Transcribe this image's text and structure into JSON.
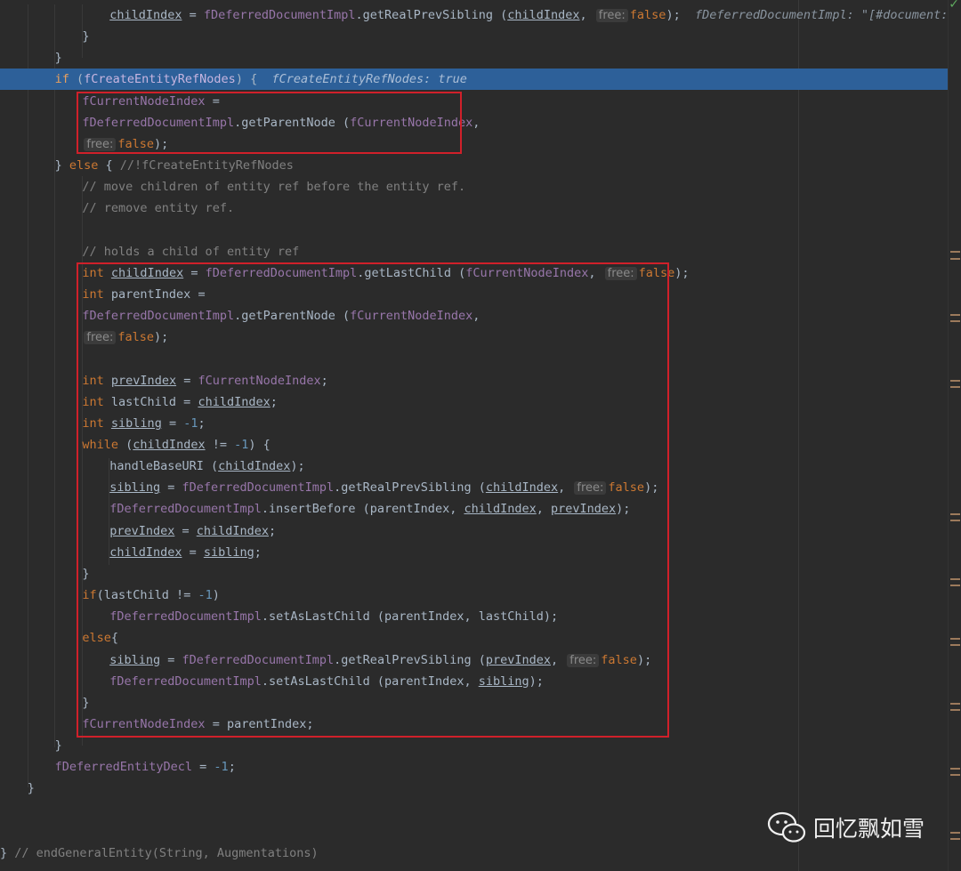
{
  "lines": [
    {
      "indent": 4,
      "tokens": [
        {
          "t": "childIndex",
          "c": "ul"
        },
        {
          "t": " = "
        },
        {
          "t": "fDeferredDocumentImpl",
          "c": "fld"
        },
        {
          "t": ".getRealPrevSibling ("
        },
        {
          "t": "childIndex",
          "c": "ul"
        },
        {
          "t": ", "
        },
        {
          "t": "free:",
          "c": "hint"
        },
        {
          "t": "false",
          "c": "kw"
        },
        {
          "t": ");"
        },
        {
          "t": "  fDeferredDocumentImpl: \"[#document: null]\"",
          "c": "dbg"
        }
      ]
    },
    {
      "indent": 3,
      "tokens": [
        {
          "t": "}"
        }
      ]
    },
    {
      "indent": 2,
      "tokens": [
        {
          "t": "}"
        }
      ]
    },
    {
      "indent": 2,
      "exec": true,
      "tokens": [
        {
          "t": "if",
          "c": "kw"
        },
        {
          "t": " ("
        },
        {
          "t": "fCreateEntityRefNodes",
          "c": "fld"
        },
        {
          "t": ") {  "
        },
        {
          "t": "fCreateEntityRefNodes: true",
          "c": "dbg"
        }
      ]
    },
    {
      "indent": 3,
      "tokens": [
        {
          "t": "fCurrentNodeIndex",
          "c": "fld"
        },
        {
          "t": " ="
        }
      ]
    },
    {
      "indent": 3,
      "tokens": [
        {
          "t": "fDeferredDocumentImpl",
          "c": "fld"
        },
        {
          "t": ".getParentNode ("
        },
        {
          "t": "fCurrentNodeIndex",
          "c": "fld"
        },
        {
          "t": ","
        }
      ]
    },
    {
      "indent": 3,
      "tokens": [
        {
          "t": "free:",
          "c": "hint"
        },
        {
          "t": "false",
          "c": "kw"
        },
        {
          "t": ");"
        }
      ]
    },
    {
      "indent": 2,
      "tokens": [
        {
          "t": "} "
        },
        {
          "t": "else",
          "c": "kw"
        },
        {
          "t": " { "
        },
        {
          "t": "//!fCreateEntityRefNodes",
          "c": "cmt"
        }
      ]
    },
    {
      "indent": 3,
      "tokens": [
        {
          "t": "// move children of entity ref before the entity ref.",
          "c": "cmt"
        }
      ]
    },
    {
      "indent": 3,
      "tokens": [
        {
          "t": "// remove entity ref.",
          "c": "cmt"
        }
      ]
    },
    {
      "indent": 0,
      "tokens": []
    },
    {
      "indent": 3,
      "tokens": [
        {
          "t": "// holds a child of entity ref",
          "c": "cmt"
        }
      ]
    },
    {
      "indent": 3,
      "tokens": [
        {
          "t": "int",
          "c": "kw"
        },
        {
          "t": " "
        },
        {
          "t": "childIndex",
          "c": "ul"
        },
        {
          "t": " = "
        },
        {
          "t": "fDeferredDocumentImpl",
          "c": "fld"
        },
        {
          "t": ".getLastChild ("
        },
        {
          "t": "fCurrentNodeIndex",
          "c": "fld"
        },
        {
          "t": ", "
        },
        {
          "t": "free:",
          "c": "hint"
        },
        {
          "t": "false",
          "c": "kw"
        },
        {
          "t": ");"
        }
      ]
    },
    {
      "indent": 3,
      "tokens": [
        {
          "t": "int",
          "c": "kw"
        },
        {
          "t": " parentIndex ="
        }
      ]
    },
    {
      "indent": 3,
      "tokens": [
        {
          "t": "fDeferredDocumentImpl",
          "c": "fld"
        },
        {
          "t": ".getParentNode ("
        },
        {
          "t": "fCurrentNodeIndex",
          "c": "fld"
        },
        {
          "t": ","
        }
      ]
    },
    {
      "indent": 3,
      "tokens": [
        {
          "t": "free:",
          "c": "hint"
        },
        {
          "t": "false",
          "c": "kw"
        },
        {
          "t": ");"
        }
      ]
    },
    {
      "indent": 0,
      "tokens": []
    },
    {
      "indent": 3,
      "tokens": [
        {
          "t": "int",
          "c": "kw"
        },
        {
          "t": " "
        },
        {
          "t": "prevIndex",
          "c": "ul"
        },
        {
          "t": " = "
        },
        {
          "t": "fCurrentNodeIndex",
          "c": "fld"
        },
        {
          "t": ";"
        }
      ]
    },
    {
      "indent": 3,
      "tokens": [
        {
          "t": "int",
          "c": "kw"
        },
        {
          "t": " lastChild = "
        },
        {
          "t": "childIndex",
          "c": "ul"
        },
        {
          "t": ";"
        }
      ]
    },
    {
      "indent": 3,
      "tokens": [
        {
          "t": "int",
          "c": "kw"
        },
        {
          "t": " "
        },
        {
          "t": "sibling",
          "c": "ul"
        },
        {
          "t": " = "
        },
        {
          "t": "-1",
          "c": "num"
        },
        {
          "t": ";"
        }
      ]
    },
    {
      "indent": 3,
      "tokens": [
        {
          "t": "while",
          "c": "kw"
        },
        {
          "t": " ("
        },
        {
          "t": "childIndex",
          "c": "ul"
        },
        {
          "t": " != "
        },
        {
          "t": "-1",
          "c": "num"
        },
        {
          "t": ") {"
        }
      ]
    },
    {
      "indent": 4,
      "tokens": [
        {
          "t": "handleBaseURI ("
        },
        {
          "t": "childIndex",
          "c": "ul"
        },
        {
          "t": ");"
        }
      ]
    },
    {
      "indent": 4,
      "tokens": [
        {
          "t": "sibling",
          "c": "ul"
        },
        {
          "t": " = "
        },
        {
          "t": "fDeferredDocumentImpl",
          "c": "fld"
        },
        {
          "t": ".getRealPrevSibling ("
        },
        {
          "t": "childIndex",
          "c": "ul"
        },
        {
          "t": ", "
        },
        {
          "t": "free:",
          "c": "hint"
        },
        {
          "t": "false",
          "c": "kw"
        },
        {
          "t": ");"
        }
      ]
    },
    {
      "indent": 4,
      "tokens": [
        {
          "t": "fDeferredDocumentImpl",
          "c": "fld"
        },
        {
          "t": ".insertBefore (parentIndex, "
        },
        {
          "t": "childIndex",
          "c": "ul"
        },
        {
          "t": ", "
        },
        {
          "t": "prevIndex",
          "c": "ul"
        },
        {
          "t": ");"
        }
      ]
    },
    {
      "indent": 4,
      "tokens": [
        {
          "t": "prevIndex",
          "c": "ul"
        },
        {
          "t": " = "
        },
        {
          "t": "childIndex",
          "c": "ul"
        },
        {
          "t": ";"
        }
      ]
    },
    {
      "indent": 4,
      "tokens": [
        {
          "t": "childIndex",
          "c": "ul"
        },
        {
          "t": " = "
        },
        {
          "t": "sibling",
          "c": "ul"
        },
        {
          "t": ";"
        }
      ]
    },
    {
      "indent": 3,
      "tokens": [
        {
          "t": "}"
        }
      ]
    },
    {
      "indent": 3,
      "tokens": [
        {
          "t": "if",
          "c": "kw"
        },
        {
          "t": "(lastChild != "
        },
        {
          "t": "-1",
          "c": "num"
        },
        {
          "t": ")"
        }
      ]
    },
    {
      "indent": 4,
      "tokens": [
        {
          "t": "fDeferredDocumentImpl",
          "c": "fld"
        },
        {
          "t": ".setAsLastChild (parentIndex, lastChild);"
        }
      ]
    },
    {
      "indent": 3,
      "tokens": [
        {
          "t": "else",
          "c": "kw"
        },
        {
          "t": "{"
        }
      ]
    },
    {
      "indent": 4,
      "tokens": [
        {
          "t": "sibling",
          "c": "ul"
        },
        {
          "t": " = "
        },
        {
          "t": "fDeferredDocumentImpl",
          "c": "fld"
        },
        {
          "t": ".getRealPrevSibling ("
        },
        {
          "t": "prevIndex",
          "c": "ul"
        },
        {
          "t": ", "
        },
        {
          "t": "free:",
          "c": "hint"
        },
        {
          "t": "false",
          "c": "kw"
        },
        {
          "t": ");"
        }
      ]
    },
    {
      "indent": 4,
      "tokens": [
        {
          "t": "fDeferredDocumentImpl",
          "c": "fld"
        },
        {
          "t": ".setAsLastChild (parentIndex, "
        },
        {
          "t": "sibling",
          "c": "ul"
        },
        {
          "t": ");"
        }
      ]
    },
    {
      "indent": 3,
      "tokens": [
        {
          "t": "}"
        }
      ]
    },
    {
      "indent": 3,
      "tokens": [
        {
          "t": "fCurrentNodeIndex",
          "c": "fld"
        },
        {
          "t": " = parentIndex;"
        }
      ]
    },
    {
      "indent": 2,
      "tokens": [
        {
          "t": "}"
        }
      ]
    },
    {
      "indent": 2,
      "tokens": [
        {
          "t": "fDeferredEntityDecl",
          "c": "fld"
        },
        {
          "t": " = "
        },
        {
          "t": "-1",
          "c": "num"
        },
        {
          "t": ";"
        }
      ]
    },
    {
      "indent": 1,
      "tokens": [
        {
          "t": "}"
        }
      ]
    },
    {
      "indent": 0,
      "tokens": []
    },
    {
      "indent": 0,
      "tokens": []
    },
    {
      "indent": 0,
      "tokens": [
        {
          "t": "} "
        },
        {
          "t": "// endGeneralEntity(String, Augmentations)",
          "c": "cmt"
        }
      ]
    }
  ],
  "watermark": {
    "text": "回忆飘如雪",
    "icon": "wechat-icon"
  },
  "inspection": {
    "icon": "check-icon",
    "mark": "✓"
  },
  "colors": {
    "background": "#2b2b2b",
    "execution_line": "#2d6099",
    "highlight_box": "#d0202a",
    "keyword": "#cc7832",
    "field": "#9876aa",
    "number": "#6897bb",
    "comment": "#808080"
  }
}
